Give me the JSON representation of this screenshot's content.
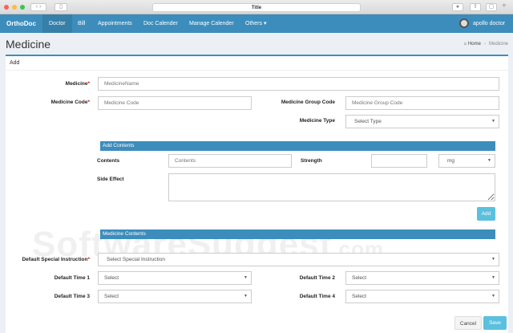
{
  "browser": {
    "title": "Title"
  },
  "nav": {
    "brand": "OrthoDoc",
    "items": [
      "Doctor",
      "Bill",
      "Appointments",
      "Doc Calender",
      "Manage Calender",
      "Others ▾"
    ],
    "user": "apollo doctor"
  },
  "header": {
    "title": "Medicine",
    "breadcrumb": [
      "Home",
      "Medicine"
    ]
  },
  "box": {
    "title": "Add"
  },
  "form": {
    "medicine_label": "Medicine",
    "medicine_placeholder": "MedicineName",
    "code_label": "Medicine Code",
    "code_placeholder": "Medicine Code",
    "group_label": "Medicine Group Code",
    "group_placeholder": "Medicine Group Code",
    "type_label": "Medicine Type",
    "type_value": "Select Type",
    "add_contents": "Add Contents",
    "contents_label": "Contents",
    "contents_placeholder": "Contents",
    "strength_label": "Strength",
    "unit_value": "mg",
    "side_effect_label": "Side Effect",
    "add_button": "Add",
    "medicine_contents": "Medicine Contents",
    "instruction_label": "Default Special Instruction",
    "instruction_value": "Select Special Instruction",
    "time1_label": "Default Time 1",
    "time2_label": "Default Time 2",
    "time3_label": "Default Time 3",
    "time4_label": "Default Time 4",
    "select": "Select",
    "cancel": "Cancel",
    "save": "Save",
    "required": "*"
  },
  "watermark": {
    "main": "SoftwareSuggest",
    "suffix": ".com"
  }
}
